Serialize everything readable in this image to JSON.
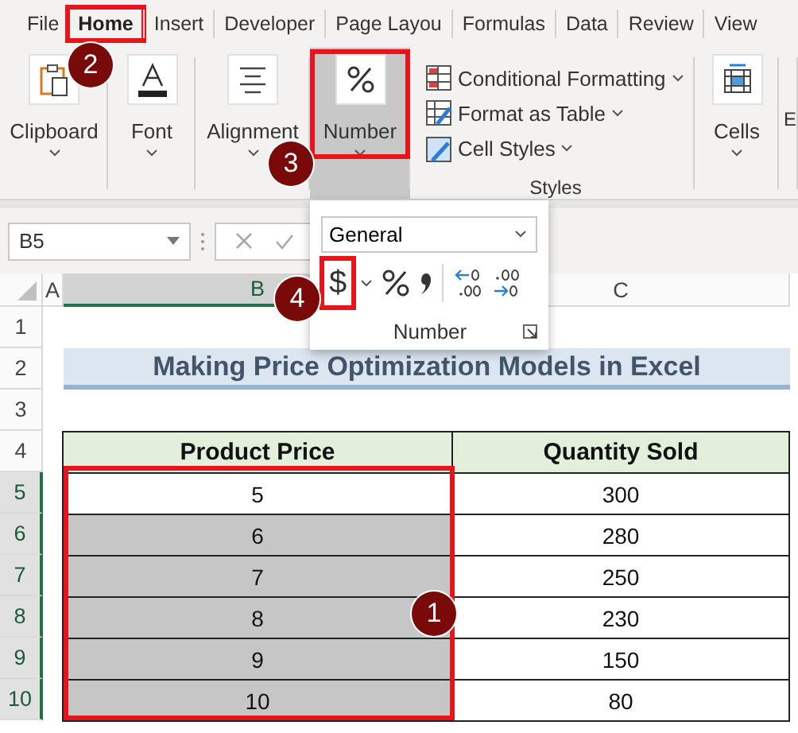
{
  "tabs": [
    {
      "label": "File",
      "selected": false
    },
    {
      "label": "Home",
      "selected": true
    },
    {
      "label": "Insert",
      "selected": false
    },
    {
      "label": "Developer",
      "selected": false
    },
    {
      "label": "Page Layou",
      "selected": false
    },
    {
      "label": "Formulas",
      "selected": false
    },
    {
      "label": "Data",
      "selected": false
    },
    {
      "label": "Review",
      "selected": false
    },
    {
      "label": "View",
      "selected": false
    }
  ],
  "ribbon": {
    "groups": [
      {
        "kind": "large",
        "label": "Clipboard",
        "pressed": false
      },
      {
        "kind": "large",
        "label": "Font",
        "pressed": false
      },
      {
        "kind": "large",
        "label": "Alignment",
        "pressed": false
      },
      {
        "kind": "large",
        "label": "Number",
        "pressed": true
      },
      {
        "kind": "list",
        "label": "Styles",
        "items": [
          {
            "label": "Conditional Formatting"
          },
          {
            "label": "Format as Table"
          },
          {
            "label": "Cell Styles"
          }
        ]
      },
      {
        "kind": "large",
        "label": "Cells",
        "pressed": false
      },
      {
        "kind": "stub",
        "label": "E"
      }
    ]
  },
  "formula_bar": {
    "name_box": "B5"
  },
  "number_popup": {
    "format": "General",
    "currency": "$",
    "label": "Number"
  },
  "columns": [
    {
      "label": "A",
      "selected": false
    },
    {
      "label": "B",
      "selected": true
    },
    {
      "label": "C",
      "selected": false
    }
  ],
  "rows": [
    {
      "header": "1",
      "selected": false
    },
    {
      "header": "2",
      "selected": false
    },
    {
      "header": "3",
      "selected": false
    },
    {
      "header": "4",
      "selected": false
    },
    {
      "header": "5",
      "selected": true
    },
    {
      "header": "6",
      "selected": true
    },
    {
      "header": "7",
      "selected": true
    },
    {
      "header": "8",
      "selected": true
    },
    {
      "header": "9",
      "selected": true
    },
    {
      "header": "10",
      "selected": true
    }
  ],
  "title": "Making Price Optimization Models in Excel",
  "table": {
    "columns": [
      "Product Price",
      "Quantity Sold"
    ],
    "rows": [
      {
        "price": "5",
        "quantity": "300",
        "selected": false
      },
      {
        "price": "6",
        "quantity": "280",
        "selected": true
      },
      {
        "price": "7",
        "quantity": "250",
        "selected": true
      },
      {
        "price": "8",
        "quantity": "230",
        "selected": true
      },
      {
        "price": "9",
        "quantity": "150",
        "selected": true
      },
      {
        "price": "10",
        "quantity": "80",
        "selected": true
      }
    ]
  },
  "annotations": [
    {
      "label": "2"
    },
    {
      "label": "3"
    },
    {
      "label": "4"
    },
    {
      "label": "1"
    }
  ]
}
